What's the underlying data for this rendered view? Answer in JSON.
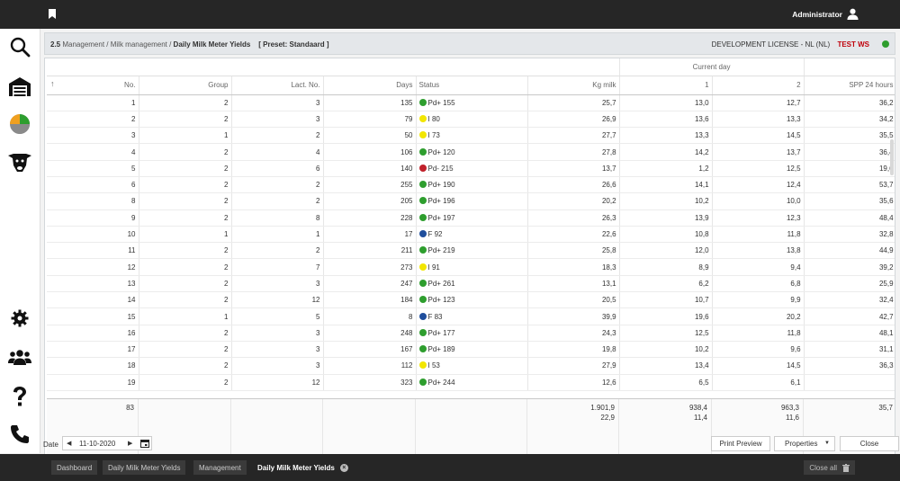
{
  "topbar": {
    "user": "Administrator"
  },
  "breadcrumb": {
    "number": "2.5",
    "crumb1": "Management",
    "crumb2": "Milk management",
    "current": "Daily Milk Meter Yields",
    "preset": "[ Preset: Standaard ]",
    "license": "DEVELOPMENT LICENSE - NL (NL)",
    "test_ws": "TEST WS"
  },
  "status_colors": {
    "green": "#2e9e2e",
    "yellow": "#f2e600",
    "red": "#c0202a",
    "blue": "#1f4e9c"
  },
  "table": {
    "group_header": "Current day",
    "columns": [
      "No.",
      "Group",
      "Lact. No.",
      "Days",
      "Status",
      "Kg milk",
      "1",
      "2",
      "SPP 24 hours"
    ],
    "rows": [
      {
        "no": "1",
        "group": "2",
        "lact": "3",
        "days": "135",
        "status_color": "green",
        "status": "Pd+ 155",
        "kg": "25,7",
        "c1": "13,0",
        "c2": "12,7",
        "spp": "36,2"
      },
      {
        "no": "2",
        "group": "2",
        "lact": "3",
        "days": "79",
        "status_color": "yellow",
        "status": "I 80",
        "kg": "26,9",
        "c1": "13,6",
        "c2": "13,3",
        "spp": "34,2"
      },
      {
        "no": "3",
        "group": "1",
        "lact": "2",
        "days": "50",
        "status_color": "yellow",
        "status": "I 73",
        "kg": "27,7",
        "c1": "13,3",
        "c2": "14,5",
        "spp": "35,5"
      },
      {
        "no": "4",
        "group": "2",
        "lact": "4",
        "days": "106",
        "status_color": "green",
        "status": "Pd+ 120",
        "kg": "27,8",
        "c1": "14,2",
        "c2": "13,7",
        "spp": "36,4"
      },
      {
        "no": "5",
        "group": "2",
        "lact": "6",
        "days": "140",
        "status_color": "red",
        "status": "Pd- 215",
        "kg": "13,7",
        "c1": "1,2",
        "c2": "12,5",
        "spp": "19,6"
      },
      {
        "no": "6",
        "group": "2",
        "lact": "2",
        "days": "255",
        "status_color": "green",
        "status": "Pd+ 190",
        "kg": "26,6",
        "c1": "14,1",
        "c2": "12,4",
        "spp": "53,7"
      },
      {
        "no": "8",
        "group": "2",
        "lact": "2",
        "days": "205",
        "status_color": "green",
        "status": "Pd+ 196",
        "kg": "20,2",
        "c1": "10,2",
        "c2": "10,0",
        "spp": "35,6"
      },
      {
        "no": "9",
        "group": "2",
        "lact": "8",
        "days": "228",
        "status_color": "green",
        "status": "Pd+ 197",
        "kg": "26,3",
        "c1": "13,9",
        "c2": "12,3",
        "spp": "48,4"
      },
      {
        "no": "10",
        "group": "1",
        "lact": "1",
        "days": "17",
        "status_color": "blue",
        "status": "F 92",
        "kg": "22,6",
        "c1": "10,8",
        "c2": "11,8",
        "spp": "32,8"
      },
      {
        "no": "11",
        "group": "2",
        "lact": "2",
        "days": "211",
        "status_color": "green",
        "status": "Pd+ 219",
        "kg": "25,8",
        "c1": "12,0",
        "c2": "13,8",
        "spp": "44,9"
      },
      {
        "no": "12",
        "group": "2",
        "lact": "7",
        "days": "273",
        "status_color": "yellow",
        "status": "I 91",
        "kg": "18,3",
        "c1": "8,9",
        "c2": "9,4",
        "spp": "39,2"
      },
      {
        "no": "13",
        "group": "2",
        "lact": "3",
        "days": "247",
        "status_color": "green",
        "status": "Pd+ 261",
        "kg": "13,1",
        "c1": "6,2",
        "c2": "6,8",
        "spp": "25,9"
      },
      {
        "no": "14",
        "group": "2",
        "lact": "12",
        "days": "184",
        "status_color": "green",
        "status": "Pd+ 123",
        "kg": "20,5",
        "c1": "10,7",
        "c2": "9,9",
        "spp": "32,4"
      },
      {
        "no": "15",
        "group": "1",
        "lact": "5",
        "days": "8",
        "status_color": "blue",
        "status": "F 83",
        "kg": "39,9",
        "c1": "19,6",
        "c2": "20,2",
        "spp": "42,7"
      },
      {
        "no": "16",
        "group": "2",
        "lact": "3",
        "days": "248",
        "status_color": "green",
        "status": "Pd+ 177",
        "kg": "24,3",
        "c1": "12,5",
        "c2": "11,8",
        "spp": "48,1"
      },
      {
        "no": "17",
        "group": "2",
        "lact": "3",
        "days": "167",
        "status_color": "green",
        "status": "Pd+ 189",
        "kg": "19,8",
        "c1": "10,2",
        "c2": "9,6",
        "spp": "31,1"
      },
      {
        "no": "18",
        "group": "2",
        "lact": "3",
        "days": "112",
        "status_color": "yellow",
        "status": "I 53",
        "kg": "27,9",
        "c1": "13,4",
        "c2": "14,5",
        "spp": "36,3"
      },
      {
        "no": "19",
        "group": "2",
        "lact": "12",
        "days": "323",
        "status_color": "green",
        "status": "Pd+ 244",
        "kg": "12,6",
        "c1": "6,5",
        "c2": "6,1",
        "spp": ""
      }
    ],
    "footer": {
      "count": "83",
      "kg_total": "1.901,9",
      "kg_avg": "22,9",
      "c1_total": "938,4",
      "c1_avg": "11,4",
      "c2_total": "963,3",
      "c2_avg": "11,6",
      "spp_avg": "35,7"
    }
  },
  "bottom": {
    "date_label": "Date",
    "date_value": "11-10-2020",
    "print_preview": "Print Preview",
    "properties": "Properties",
    "close": "Close"
  },
  "taskbar": {
    "tabs": [
      "Dashboard",
      "Daily Milk Meter Yields",
      "Management"
    ],
    "active_tab": "Daily Milk Meter Yields",
    "close_all": "Close all"
  }
}
